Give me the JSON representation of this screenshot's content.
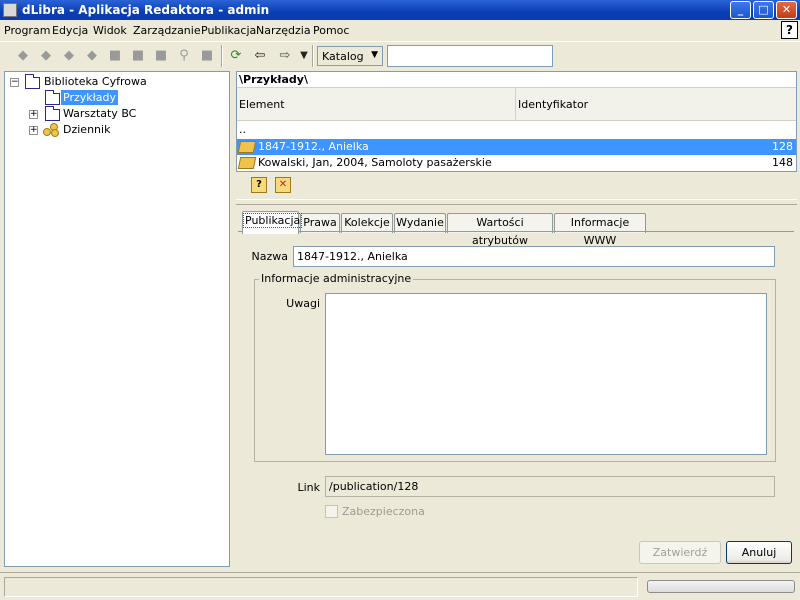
{
  "window": {
    "title": "dLibra - Aplikacja Redaktora - admin"
  },
  "menu": [
    "Program",
    "Edycja",
    "Widok",
    "Zarządzanie",
    "Publikacja",
    "Narzędzia",
    "Pomoc"
  ],
  "help_corner": "?",
  "toolbar": {
    "catalog_value": "Katalog",
    "search_value": "",
    "icons": [
      "add-folder-icon",
      "add-document-icon",
      "move-icon",
      "tools-icon",
      "lock-icon",
      "delete-icon",
      "edit-document-icon",
      "search-icon",
      "properties-icon",
      "refresh-icon",
      "back-arrow-icon",
      "forward-arrow-icon",
      "dropdown-arrow-icon"
    ]
  },
  "tree": {
    "root": "Biblioteka Cyfrowa",
    "items": [
      {
        "label": "Przykłady",
        "selected": true
      },
      {
        "label": "Warsztaty BC",
        "selected": false
      },
      {
        "label": "Dziennik",
        "selected": false
      }
    ]
  },
  "results": {
    "path": "\\Przykłady\\",
    "columns": {
      "element": "Element",
      "identifier": "Identyfikator"
    },
    "up_row": "..",
    "rows": [
      {
        "name": "1847-1912., Anielka",
        "id": "128",
        "selected": true
      },
      {
        "name": "Kowalski, Jan, 2004, Samoloty pasażerskie",
        "id": "148",
        "selected": false
      }
    ],
    "actions": [
      "help-query-icon",
      "delete-book-icon"
    ]
  },
  "tabs": [
    "Publikacja",
    "Prawa",
    "Kolekcje",
    "Wydanie",
    "Wartości atrybutów",
    "Informacje WWW"
  ],
  "form": {
    "name_label": "Nazwa",
    "name_value": "1847-1912., Anielka",
    "admin_group_title": "Informacje administracyjne",
    "notes_label": "Uwagi",
    "notes_value": "",
    "link_label": "Link",
    "link_value": "/publication/128",
    "secured_label": "Zabezpieczona",
    "confirm_button": "Zatwierdź",
    "cancel_button": "Anuluj"
  },
  "window_buttons": {
    "minimize": "_",
    "maximize": "□",
    "close": "✕"
  }
}
